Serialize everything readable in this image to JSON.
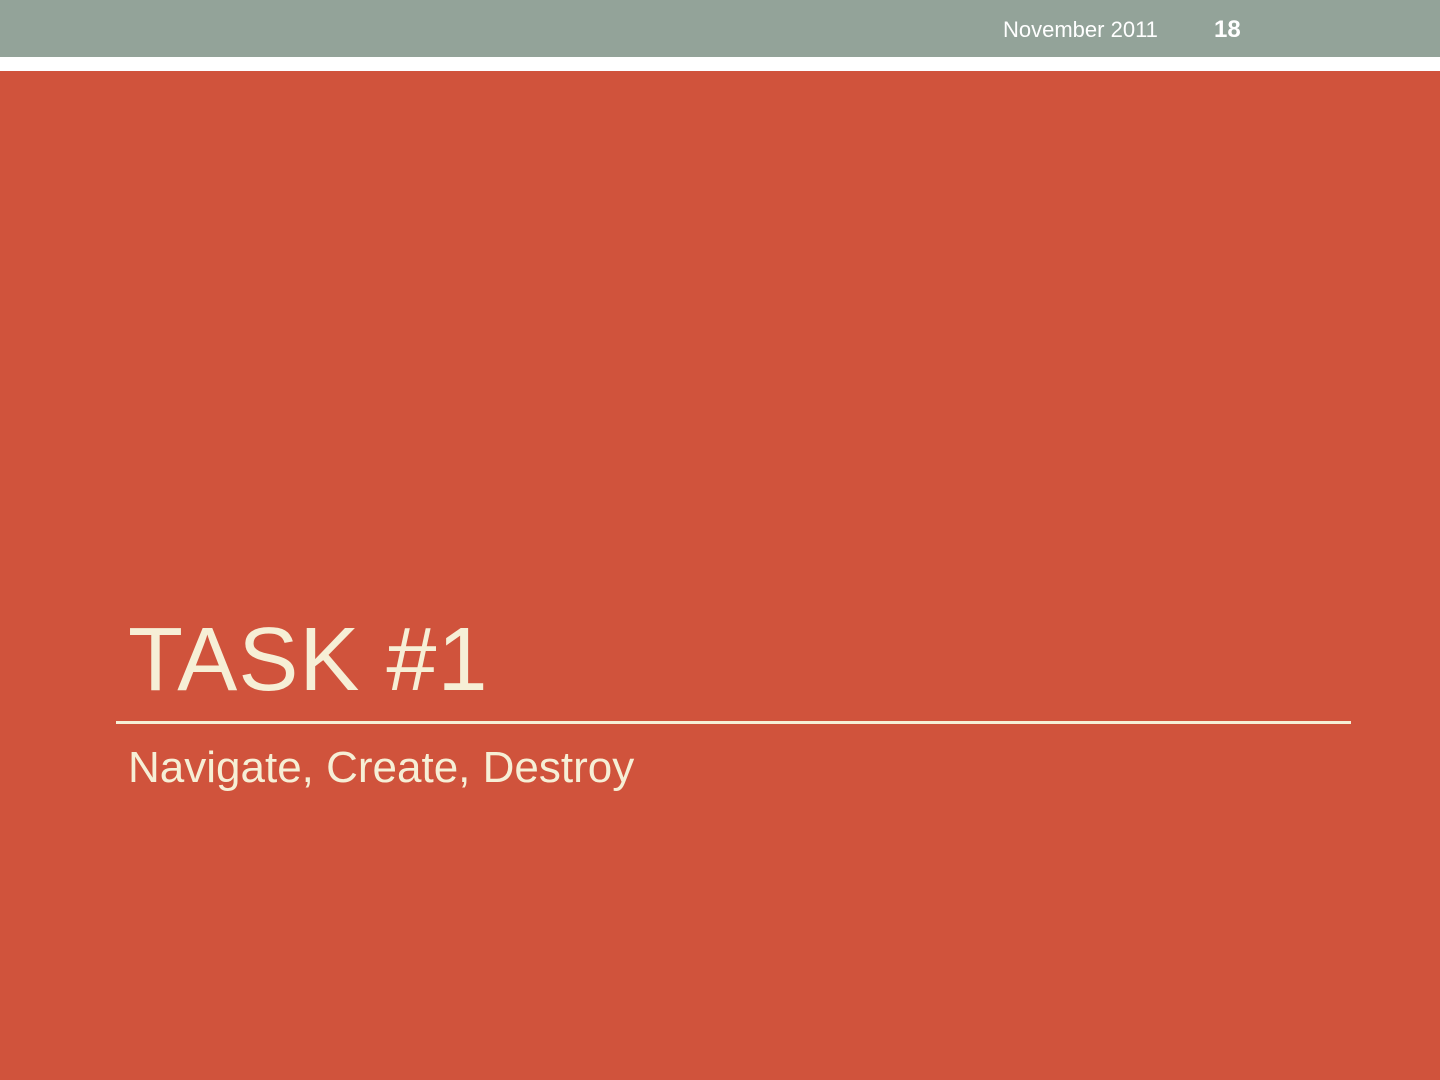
{
  "header": {
    "date": "November 2011",
    "page_number": "18"
  },
  "slide": {
    "title": "TASK #1",
    "subtitle": "Navigate, Create, Destroy"
  },
  "colors": {
    "header_band": "#93a399",
    "background": "#d0533c",
    "title_text": "#f6efd6",
    "header_text": "#ffffff"
  }
}
